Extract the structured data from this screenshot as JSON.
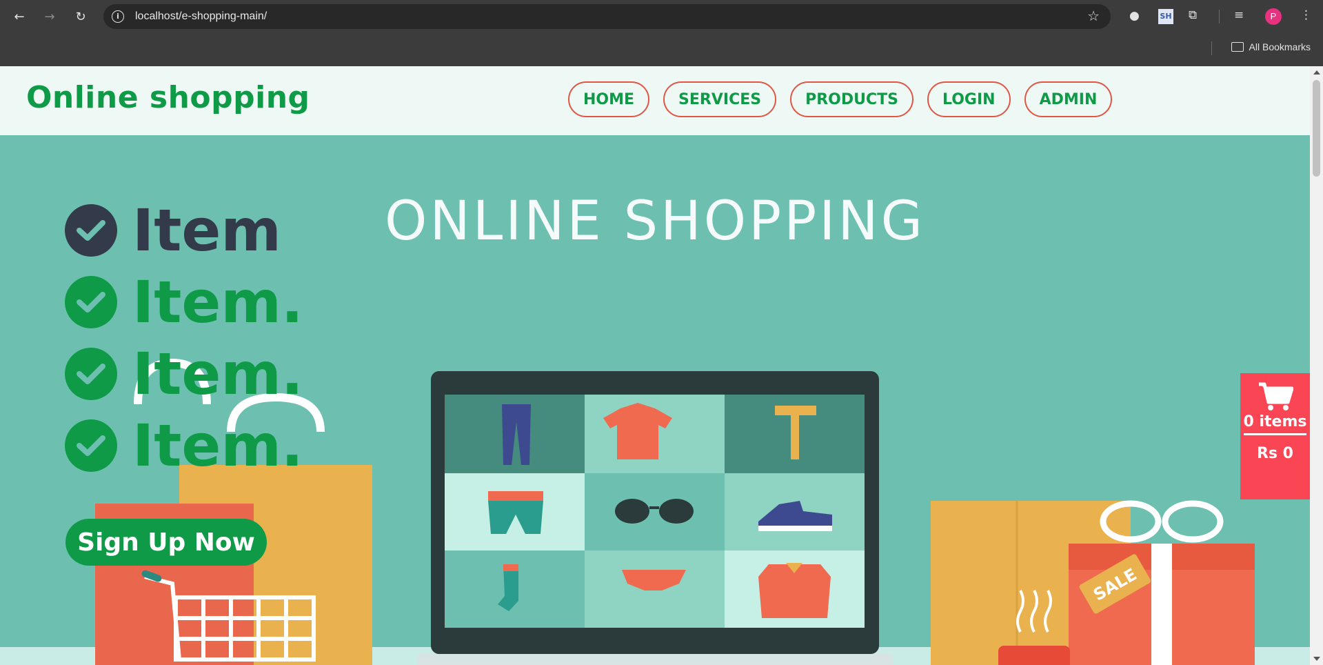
{
  "browser": {
    "url": "localhost/e-shopping-main/",
    "bookmarks_label": "All Bookmarks",
    "profile_initial": "P",
    "extension_label": "SH"
  },
  "header": {
    "logo": "Online shopping",
    "menu": [
      {
        "label": "HOME"
      },
      {
        "label": "SERVICES"
      },
      {
        "label": "PRODUCTS"
      },
      {
        "label": "LOGIN"
      },
      {
        "label": "ADMIN"
      }
    ]
  },
  "hero": {
    "banner_title": "ONLINE SHOPPING",
    "items": [
      {
        "label": "Item",
        "color": "#333a4a"
      },
      {
        "label": "Item.",
        "color": "#0e9a47"
      },
      {
        "label": "Item.",
        "color": "#0e9a47"
      },
      {
        "label": "Item.",
        "color": "#0e9a47"
      }
    ],
    "signup_label": "Sign Up Now",
    "sale_tag": "SALE"
  },
  "cart": {
    "count_label": "0 items",
    "total_label": "Rs 0"
  },
  "colors": {
    "brand_green": "#0e9a47",
    "menu_border": "#e05543",
    "hero_bg": "#6dbfb0",
    "cart_bg": "#fa4554"
  }
}
